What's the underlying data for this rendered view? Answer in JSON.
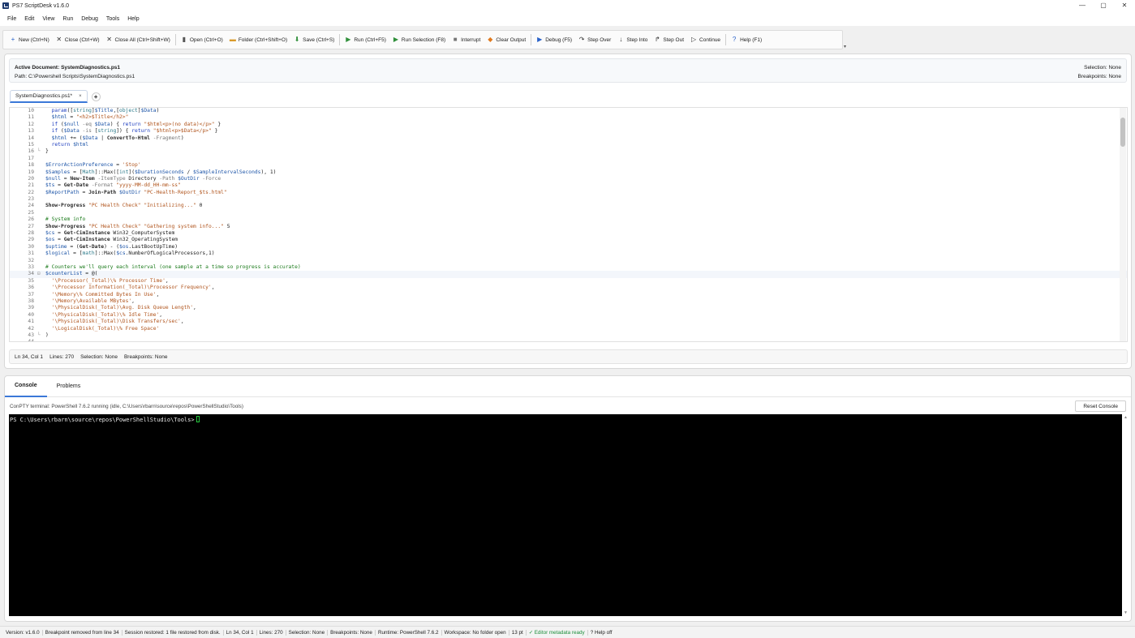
{
  "window": {
    "title": "PS7 ScriptDesk v1.6.0",
    "controls": [
      "—",
      "▢",
      "✕"
    ]
  },
  "menu": [
    "File",
    "Edit",
    "View",
    "Run",
    "Debug",
    "Tools",
    "Help"
  ],
  "toolbar": {
    "buttons": [
      {
        "label": "New (Ctrl+N)",
        "icon": "plus-icon",
        "glyph": "+",
        "color": "#2a62c9"
      },
      {
        "label": "Close (Ctrl+W)",
        "icon": "close-icon",
        "glyph": "✕",
        "color": "#333333"
      },
      {
        "label": "Close All (Ctrl+Shift+W)",
        "icon": "close-all-icon",
        "glyph": "✕",
        "color": "#333333"
      },
      {
        "label": "Open (Ctrl+O)",
        "icon": "file-icon",
        "glyph": "▮",
        "color": "#555555"
      },
      {
        "label": "Folder (Ctrl+Shift+O)",
        "icon": "folder-icon",
        "glyph": "▬",
        "color": "#d99a2b"
      },
      {
        "label": "Save (Ctrl+S)",
        "icon": "save-icon",
        "glyph": "⬇",
        "color": "#2f8f3a"
      },
      {
        "label": "Run (Ctrl+F5)",
        "icon": "play-icon",
        "glyph": "▶",
        "color": "#2f8f3a"
      },
      {
        "label": "Run Selection (F8)",
        "icon": "run-selection-icon",
        "glyph": "▶",
        "color": "#2f8f3a"
      },
      {
        "label": "Interrupt",
        "icon": "stop-icon",
        "glyph": "■",
        "color": "#777777"
      },
      {
        "label": "Clear Output",
        "icon": "eraser-icon",
        "glyph": "◆",
        "color": "#e07a1f"
      },
      {
        "label": "Debug (F5)",
        "icon": "debug-icon",
        "glyph": "▶",
        "color": "#2a62c9"
      },
      {
        "label": "Step Over",
        "icon": "step-over-icon",
        "glyph": "↷",
        "color": "#333333"
      },
      {
        "label": "Step Into",
        "icon": "step-into-icon",
        "glyph": "↓",
        "color": "#333333"
      },
      {
        "label": "Step Out",
        "icon": "step-out-icon",
        "glyph": "↱",
        "color": "#333333"
      },
      {
        "label": "Continue",
        "icon": "continue-icon",
        "glyph": "▷",
        "color": "#333333"
      },
      {
        "label": "Help (F1)",
        "icon": "help-icon",
        "glyph": "?",
        "color": "#2a62c9"
      }
    ],
    "separator_after": [
      2,
      5,
      9,
      14
    ]
  },
  "document": {
    "active_label": "Active Document: SystemDiagnostics.ps1",
    "path_label": "Path: C:\\Powershell Scripts\\SystemDiagnostics.ps1",
    "selection_label": "Selection: None",
    "breakpoints_label": "Breakpoints: None",
    "tab_label": "SystemDiagnostics.ps1*",
    "tab_close": "×",
    "tab_add": "+"
  },
  "code": {
    "current_line": 34,
    "lines": [
      {
        "n": "10",
        "fold": "",
        "html": "  <span class=\"k\">param</span>([<span class=\"t\">string</span>]<span class=\"v\">$Title</span>,[<span class=\"t\">object</span>]<span class=\"v\">$Data</span>)"
      },
      {
        "n": "11",
        "fold": "",
        "html": "  <span class=\"v\">$html</span> = <span class=\"s\">\"&lt;h2&gt;$Title&lt;/h2&gt;\"</span>"
      },
      {
        "n": "12",
        "fold": "",
        "html": "  <span class=\"k\">if</span> (<span class=\"v\">$null</span> <span class=\"p\">-eq</span> <span class=\"v\">$Data</span>) { <span class=\"k\">return</span> <span class=\"s\">\"$html&lt;p&gt;(no data)&lt;/p&gt;\"</span> }"
      },
      {
        "n": "13",
        "fold": "",
        "html": "  <span class=\"k\">if</span> (<span class=\"v\">$Data</span> <span class=\"p\">-is</span> [<span class=\"t\">string</span>]) { <span class=\"k\">return</span> <span class=\"s\">\"$html&lt;p&gt;$Data&lt;/p&gt;\"</span> }"
      },
      {
        "n": "14",
        "fold": "",
        "html": "  <span class=\"v\">$html</span> += (<span class=\"v\">$Data</span> | <span class=\"f\">ConvertTo-Html</span> <span class=\"p\">-Fragment</span>)"
      },
      {
        "n": "15",
        "fold": "",
        "html": "  <span class=\"k\">return</span> <span class=\"v\">$html</span>"
      },
      {
        "n": "16",
        "fold": "└",
        "html": "}"
      },
      {
        "n": "17",
        "fold": "",
        "html": ""
      },
      {
        "n": "18",
        "fold": "",
        "html": "<span class=\"v\">$ErrorActionPreference</span> = <span class=\"s\">'Stop'</span>"
      },
      {
        "n": "19",
        "fold": "",
        "html": "<span class=\"v\">$Samples</span> = [<span class=\"t\">Math</span>]::Max([<span class=\"t\">int</span>](<span class=\"v\">$DurationSeconds</span> / <span class=\"v\">$SampleIntervalSeconds</span>), 1)"
      },
      {
        "n": "20",
        "fold": "",
        "html": "<span class=\"v\">$null</span> = <span class=\"f\">New-Item</span> <span class=\"p\">-ItemType</span> Directory <span class=\"p\">-Path</span> <span class=\"v\">$OutDir</span> <span class=\"p\">-Force</span>"
      },
      {
        "n": "21",
        "fold": "",
        "html": "<span class=\"v\">$ts</span> = <span class=\"f\">Get-Date</span> <span class=\"p\">-Format</span> <span class=\"s\">\"yyyy-MM-dd_HH-mm-ss\"</span>"
      },
      {
        "n": "22",
        "fold": "",
        "html": "<span class=\"v\">$ReportPath</span> = <span class=\"f\">Join-Path</span> <span class=\"v\">$OutDir</span> <span class=\"s\">\"PC-Health-Report_$ts.html\"</span>"
      },
      {
        "n": "23",
        "fold": "",
        "html": ""
      },
      {
        "n": "24",
        "fold": "",
        "html": "<span class=\"f\">Show-Progress</span> <span class=\"s\">\"PC Health Check\"</span> <span class=\"s\">\"Initializing...\"</span> 0"
      },
      {
        "n": "25",
        "fold": "",
        "html": ""
      },
      {
        "n": "26",
        "fold": "",
        "html": "<span class=\"c\"># System info</span>"
      },
      {
        "n": "27",
        "fold": "",
        "html": "<span class=\"f\">Show-Progress</span> <span class=\"s\">\"PC Health Check\"</span> <span class=\"s\">\"Gathering system info...\"</span> 5"
      },
      {
        "n": "28",
        "fold": "",
        "html": "<span class=\"v\">$cs</span> = <span class=\"f\">Get-CimInstance</span> Win32_ComputerSystem"
      },
      {
        "n": "29",
        "fold": "",
        "html": "<span class=\"v\">$os</span> = <span class=\"f\">Get-CimInstance</span> Win32_OperatingSystem"
      },
      {
        "n": "30",
        "fold": "",
        "html": "<span class=\"v\">$uptime</span> = (<span class=\"f\">Get-Date</span>) - (<span class=\"v\">$os</span>.LastBootUpTime)"
      },
      {
        "n": "31",
        "fold": "",
        "html": "<span class=\"v\">$logical</span> = [<span class=\"t\">math</span>]::Max(<span class=\"v\">$cs</span>.NumberOfLogicalProcessors,1)"
      },
      {
        "n": "32",
        "fold": "",
        "html": ""
      },
      {
        "n": "33",
        "fold": "",
        "html": "<span class=\"c\"># Counters we'll query each interval (one sample at a time so progress is accurate)</span>"
      },
      {
        "n": "34",
        "fold": "⊟",
        "html": "<span class=\"v\">$counterList</span> = @("
      },
      {
        "n": "35",
        "fold": "",
        "html": "  <span class=\"s\">'\\Processor(_Total)\\% Processor Time'</span>,"
      },
      {
        "n": "36",
        "fold": "",
        "html": "  <span class=\"s\">'\\Processor Information(_Total)\\Processor Frequency'</span>,"
      },
      {
        "n": "37",
        "fold": "",
        "html": "  <span class=\"s\">'\\Memory\\% Committed Bytes In Use'</span>,"
      },
      {
        "n": "38",
        "fold": "",
        "html": "  <span class=\"s\">'\\Memory\\Available MBytes'</span>,"
      },
      {
        "n": "39",
        "fold": "",
        "html": "  <span class=\"s\">'\\PhysicalDisk(_Total)\\Avg. Disk Queue Length'</span>,"
      },
      {
        "n": "40",
        "fold": "",
        "html": "  <span class=\"s\">'\\PhysicalDisk(_Total)\\% Idle Time'</span>,"
      },
      {
        "n": "41",
        "fold": "",
        "html": "  <span class=\"s\">'\\PhysicalDisk(_Total)\\Disk Transfers/sec'</span>,"
      },
      {
        "n": "42",
        "fold": "",
        "html": "  <span class=\"s\">'\\LogicalDisk(_Total)\\% Free Space'</span>"
      },
      {
        "n": "43",
        "fold": "└",
        "html": ")"
      },
      {
        "n": "44",
        "fold": "",
        "html": ""
      }
    ]
  },
  "editor_status": [
    "Ln 34, Col 1",
    "Lines: 270",
    "Selection: None",
    "Breakpoints: None"
  ],
  "console": {
    "tabs": [
      "Console",
      "Problems"
    ],
    "active_tab": 0,
    "status": "ConPTY terminal: PowerShell 7.6.2 running (idle, C:\\Users\\rbarn\\source\\repos\\PowerShellStudio\\Tools)",
    "reset_label": "Reset Console",
    "prompt": "PS C:\\Users\\rbarn\\source\\repos\\PowerShellStudio\\Tools>"
  },
  "statusbar": [
    "Version: v1.6.0",
    "Breakpoint removed from line 34",
    "Session restored: 1 file restored from disk.",
    "Ln 34, Col 1",
    "Lines: 270",
    "Selection: None",
    "Breakpoints: None",
    "Runtime: PowerShell 7.6.2",
    "Workspace: No folder open",
    "13 pt",
    "✓ Editor metadata ready",
    "? Help off"
  ]
}
